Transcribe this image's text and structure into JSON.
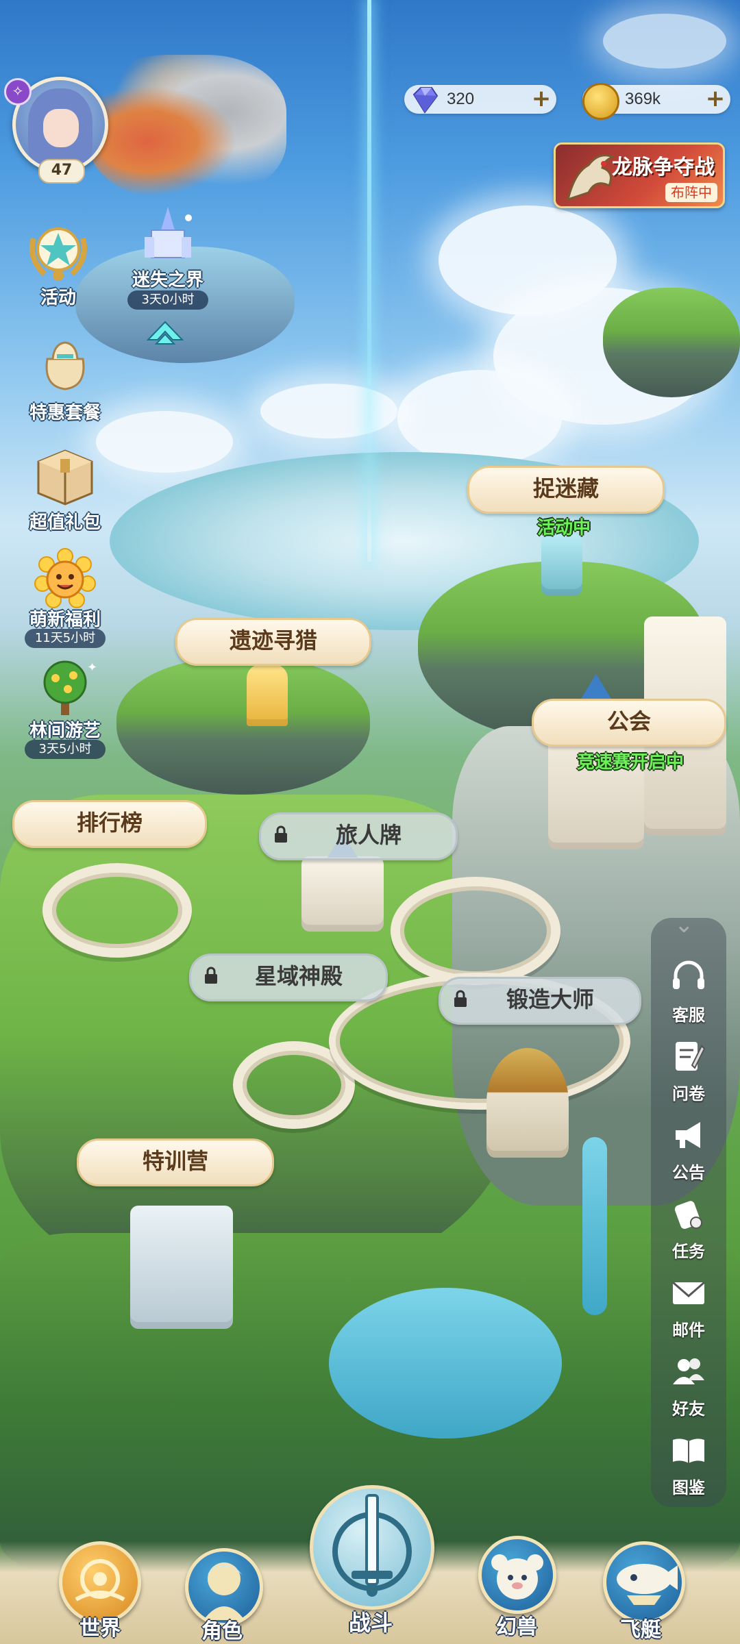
{
  "player": {
    "level": "47"
  },
  "resources": {
    "gems": {
      "value": "320",
      "icon": "gem-icon"
    },
    "gold": {
      "value": "369k",
      "icon": "coin-icon"
    }
  },
  "event_banner": {
    "title": "龙脉争夺战",
    "tag": "布阵中"
  },
  "left_menu": [
    {
      "label": "活动",
      "icon": "star-laurel-icon"
    },
    {
      "label": "特惠套餐",
      "icon": "gift-bag-icon"
    },
    {
      "label": "超值礼包",
      "icon": "gift-box-icon"
    },
    {
      "label": "萌新福利",
      "timer": "11天5小时",
      "icon": "sunflower-icon"
    },
    {
      "label": "林间游艺",
      "timer": "3天5小时",
      "icon": "tree-icon"
    }
  ],
  "lost_realm": {
    "label": "迷失之界",
    "timer": "3天0小时"
  },
  "map_labels": {
    "hide_seek": {
      "label": "捉迷藏",
      "status": "活动中"
    },
    "ruins_hunt": {
      "label": "遗迹寻猎"
    },
    "guild": {
      "label": "公会",
      "status": "竞速赛开启中"
    },
    "ranking": {
      "label": "排行榜"
    },
    "traveler_card": {
      "label": "旅人牌"
    },
    "star_temple": {
      "label": "星域神殿"
    },
    "forge_master": {
      "label": "锻造大师"
    },
    "training_camp": {
      "label": "特训营"
    }
  },
  "right_menu": [
    {
      "label": "客服",
      "icon": "headset-icon"
    },
    {
      "label": "问卷",
      "icon": "survey-icon"
    },
    {
      "label": "公告",
      "icon": "megaphone-icon"
    },
    {
      "label": "任务",
      "icon": "scroll-icon"
    },
    {
      "label": "邮件",
      "icon": "mail-icon"
    },
    {
      "label": "好友",
      "icon": "friends-icon"
    },
    {
      "label": "图鉴",
      "icon": "book-icon"
    }
  ],
  "bottom_nav": [
    {
      "label": "世界",
      "icon": "world-icon",
      "active": true
    },
    {
      "label": "角色",
      "icon": "character-icon"
    },
    {
      "label": "战斗",
      "icon": "sword-icon"
    },
    {
      "label": "幻兽",
      "icon": "beast-icon"
    },
    {
      "label": "飞艇",
      "icon": "airship-icon"
    }
  ],
  "colors": {
    "label_text": "#5a3a1a",
    "status_green": "#6ef05a",
    "accent_gold": "#f2d68a"
  }
}
